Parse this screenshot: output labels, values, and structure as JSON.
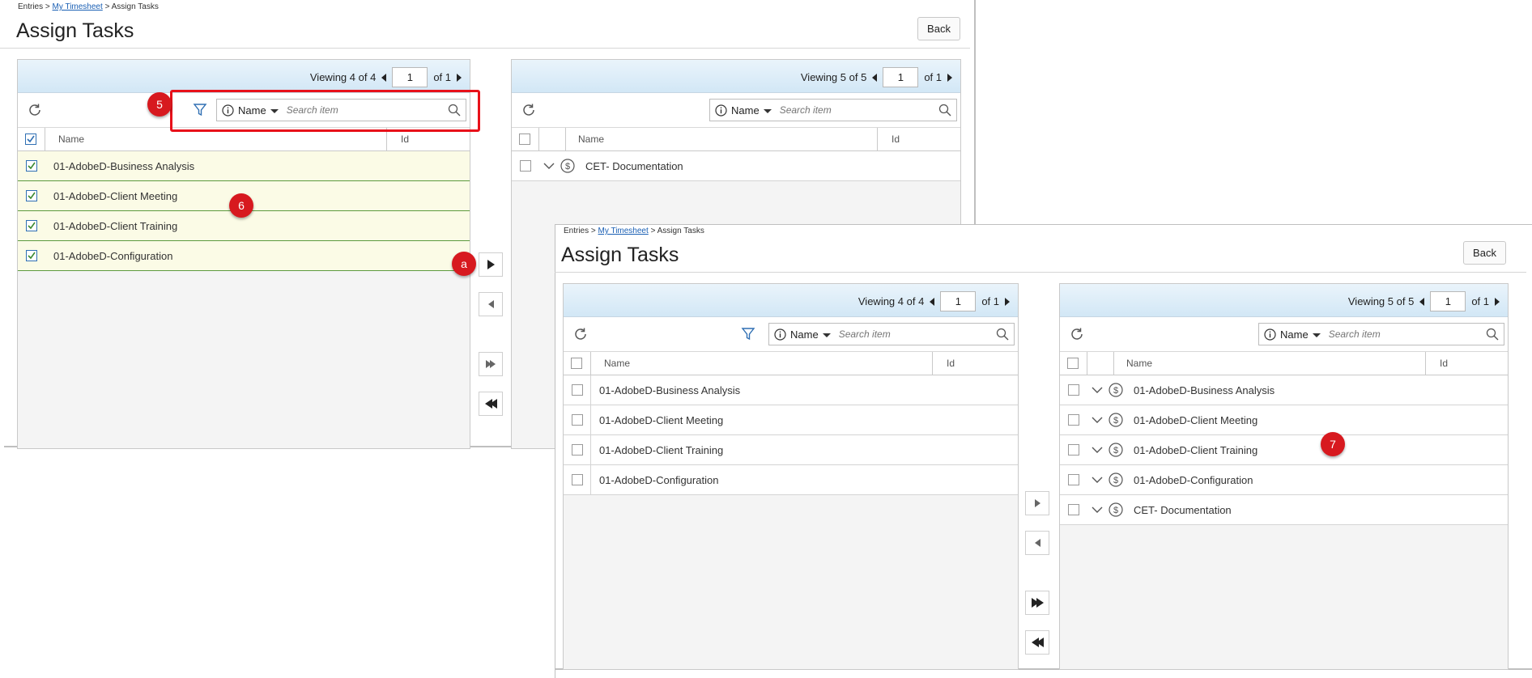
{
  "breadcrumb": {
    "root": "Entries",
    "sep": ">",
    "link": "My Timesheet",
    "current": "Assign Tasks"
  },
  "page_title": "Assign Tasks",
  "back_label": "Back",
  "toolbar": {
    "filter_field": "Name",
    "search_placeholder": "Search item"
  },
  "columns": {
    "name": "Name",
    "id": "Id"
  },
  "pager": {
    "of_label": "of 1",
    "page_value": "1"
  },
  "left_viewing": "Viewing 4 of 4",
  "right_viewing": "Viewing 5 of 5",
  "tasks": [
    "01-AdobeD-Business Analysis",
    "01-AdobeD-Client Meeting",
    "01-AdobeD-Client Training",
    "01-AdobeD-Configuration",
    "CET- Documentation"
  ],
  "markers": {
    "m5": "5",
    "m6": "6",
    "ma": "a",
    "m7": "7"
  },
  "colors": {
    "marker": "#d7191f",
    "highlight": "#e8111a",
    "selected_row": "#fbfbe6",
    "link": "#1a5fb4"
  },
  "icons": [
    "refresh-icon",
    "filter-icon",
    "info-icon",
    "search-icon",
    "chevron-down-icon",
    "dollar-icon",
    "arrow-right-icon",
    "arrow-left-icon",
    "double-arrow-right-icon",
    "double-arrow-left-icon",
    "checkmark-icon"
  ]
}
